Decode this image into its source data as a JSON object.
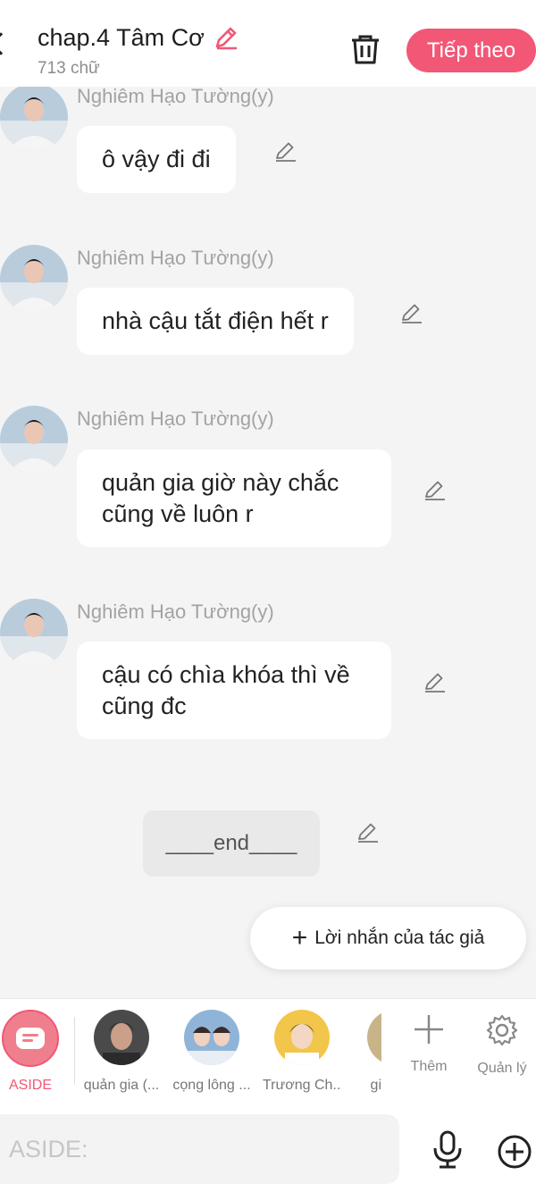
{
  "header": {
    "title": "chap.4 Tâm Cơ",
    "word_count": "713 chữ",
    "next_label": "Tiếp theo"
  },
  "messages": [
    {
      "sender": "Nghiêm Hạo Tường(y)",
      "text": "ô vậy đi đi"
    },
    {
      "sender": "Nghiêm Hạo Tường(y)",
      "text": "nhà cậu tắt điện hết r"
    },
    {
      "sender": "Nghiêm Hạo Tường(y)",
      "text": "quản gia giờ này chắc\ncũng về luôn r"
    },
    {
      "sender": "Nghiêm Hạo Tường(y)",
      "text": "cậu có chìa khóa thì về\ncũng đc"
    }
  ],
  "end_text": "____end____",
  "author_note_label": "Lời nhắn của tác giả",
  "characters": [
    {
      "label": "ASIDE"
    },
    {
      "label": "quản gia (..."
    },
    {
      "label": "cọng lông ..."
    },
    {
      "label": "Trương Ch..."
    },
    {
      "label": "gi"
    }
  ],
  "tools": {
    "add_label": "Thêm",
    "manage_label": "Quản lý"
  },
  "input": {
    "placeholder": "ASIDE:"
  },
  "colors": {
    "accent": "#f25776",
    "background": "#f4f4f4"
  }
}
